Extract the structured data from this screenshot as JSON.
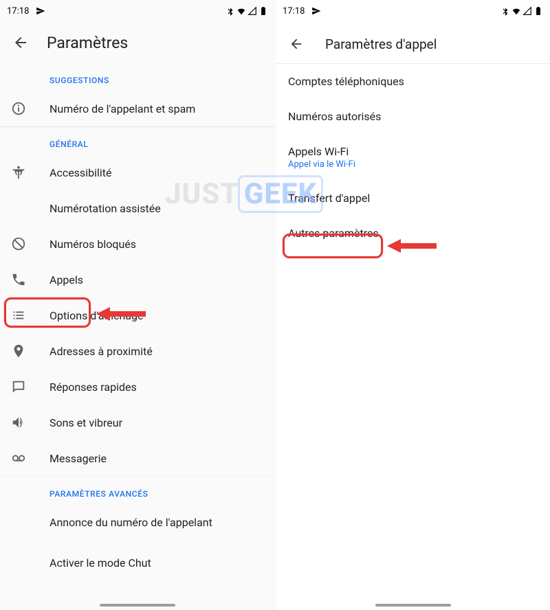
{
  "statusbar": {
    "time": "17:18"
  },
  "watermark": {
    "part1": "JUST",
    "part2": "GEEK"
  },
  "left": {
    "title": "Paramètres",
    "section_suggestions": "SUGGESTIONS",
    "item_callerid_spam": "Numéro de l'appelant et spam",
    "section_general": "GÉNÉRAL",
    "item_accessibility": "Accessibilité",
    "item_assisted_dialing": "Numérotation assistée",
    "item_blocked": "Numéros bloqués",
    "item_calls": "Appels",
    "item_display": "Options d'affichage",
    "item_nearby": "Adresses à proximité",
    "item_quick_responses": "Réponses rapides",
    "item_sounds": "Sons et vibreur",
    "item_voicemail": "Messagerie",
    "section_advanced": "PARAMÈTRES AVANCÉS",
    "item_announce": "Annonce du numéro de l'appelant",
    "item_flip": "Activer le mode Chut"
  },
  "right": {
    "title": "Paramètres d'appel",
    "item_accounts": "Comptes téléphoniques",
    "item_fdn": "Numéros autorisés",
    "item_wifi": "Appels Wi-Fi",
    "item_wifi_sub": "Appel via le Wi-Fi",
    "item_forwarding": "Transfert d'appel",
    "item_additional": "Autres paramètres"
  }
}
